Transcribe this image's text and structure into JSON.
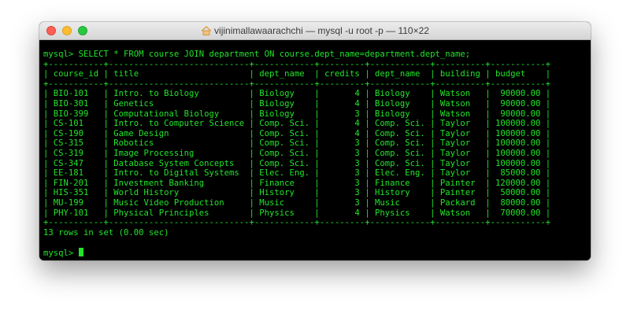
{
  "window": {
    "title": "vijinimallawaarachchi — mysql -u root -p — 110×22",
    "title_icon": "home-icon"
  },
  "terminal": {
    "query_line": "mysql> SELECT * FROM course JOIN department ON course.dept_name=department.dept_name;",
    "table": {
      "border": "+-----------+----------------------------+------------+---------+------------+----------+-----------+",
      "headers": [
        "course_id",
        "title",
        "dept_name",
        "credits",
        "dept_name",
        "building",
        "budget"
      ],
      "rows": [
        [
          "BIO-101",
          "Intro. to Biology",
          "Biology",
          "4",
          "Biology",
          "Watson",
          "90000.00"
        ],
        [
          "BIO-301",
          "Genetics",
          "Biology",
          "4",
          "Biology",
          "Watson",
          "90000.00"
        ],
        [
          "BIO-399",
          "Computational Biology",
          "Biology",
          "3",
          "Biology",
          "Watson",
          "90000.00"
        ],
        [
          "CS-101",
          "Intro. to Computer Science",
          "Comp. Sci.",
          "4",
          "Comp. Sci.",
          "Taylor",
          "100000.00"
        ],
        [
          "CS-190",
          "Game Design",
          "Comp. Sci.",
          "4",
          "Comp. Sci.",
          "Taylor",
          "100000.00"
        ],
        [
          "CS-315",
          "Robotics",
          "Comp. Sci.",
          "3",
          "Comp. Sci.",
          "Taylor",
          "100000.00"
        ],
        [
          "CS-319",
          "Image Processing",
          "Comp. Sci.",
          "3",
          "Comp. Sci.",
          "Taylor",
          "100000.00"
        ],
        [
          "CS-347",
          "Database System Concepts",
          "Comp. Sci.",
          "3",
          "Comp. Sci.",
          "Taylor",
          "100000.00"
        ],
        [
          "EE-181",
          "Intro. to Digital Systems",
          "Elec. Eng.",
          "3",
          "Elec. Eng.",
          "Taylor",
          "85000.00"
        ],
        [
          "FIN-201",
          "Investment Banking",
          "Finance",
          "3",
          "Finance",
          "Painter",
          "120000.00"
        ],
        [
          "HIS-351",
          "World History",
          "History",
          "3",
          "History",
          "Painter",
          "50000.00"
        ],
        [
          "MU-199",
          "Music Video Production",
          "Music",
          "3",
          "Music",
          "Packard",
          "80000.00"
        ],
        [
          "PHY-101",
          "Physical Principles",
          "Physics",
          "4",
          "Physics",
          "Watson",
          "70000.00"
        ]
      ]
    },
    "result_line": "13 rows in set (0.00 sec)",
    "prompt": "mysql> ",
    "colors": {
      "text": "#22e32a",
      "background": "#000000"
    }
  }
}
